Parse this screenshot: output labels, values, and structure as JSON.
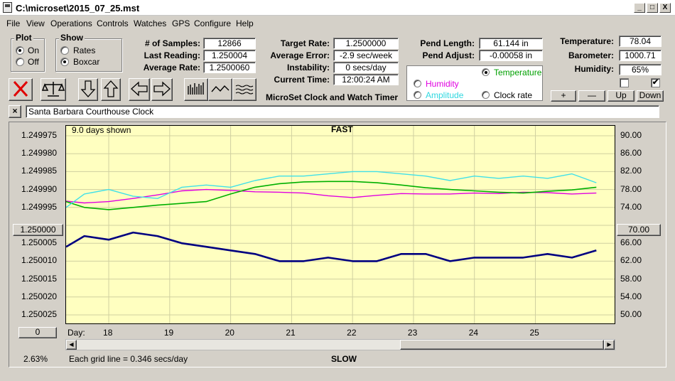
{
  "window": {
    "title": "C:\\microset\\2015_07_25.mst",
    "minimize": "_",
    "maximize": "□",
    "close": "X"
  },
  "menu": [
    "File",
    "View",
    "Operations",
    "Controls",
    "Watches",
    "GPS",
    "Configure",
    "Help"
  ],
  "plot_group": {
    "title": "Plot",
    "on": "On",
    "off": "Off",
    "selected": "On"
  },
  "show_group": {
    "title": "Show",
    "rates": "Rates",
    "boxcar": "Boxcar",
    "selected": "Boxcar"
  },
  "stats": {
    "samples_label": "# of Samples:",
    "samples": "12866",
    "last_label": "Last Reading:",
    "last": "1.250004",
    "avg_label": "Average Rate:",
    "avg": "1.2500060"
  },
  "rates": {
    "target_label": "Target Rate:",
    "target": "1.2500000",
    "error_label": "Average Error:",
    "error": "-2.9 sec/week",
    "instab_label": "Instability:",
    "instab": "0 secs/day",
    "time_label": "Current Time:",
    "time": "12:00:24 AM"
  },
  "pend": {
    "length_label": "Pend Length:",
    "length": "61.144 in",
    "adjust_label": "Pend Adjust:",
    "adjust": "-0.00058 in"
  },
  "env": {
    "temp_label": "Temperature:",
    "temp": "78.04",
    "baro_label": "Barometer:",
    "baro": "1000.71",
    "hum_label": "Humidity:",
    "hum": "65%"
  },
  "aux_select": {
    "temperature": "Temperature",
    "humidity": "Humidity",
    "amplitude": "Amplitude",
    "clock_rate": "Clock rate",
    "selected": "Temperature"
  },
  "aux_buttons": {
    "plus": "+",
    "minus": "—",
    "up": "Up",
    "down": "Down"
  },
  "app_caption": "MicroSet Clock and Watch Timer",
  "description": "Santa Barbara Courthouse Clock",
  "toolbar_icons": [
    "stop-icon",
    "balance-icon",
    "arrow-down-icon",
    "arrow-up-icon",
    "arrow-left-icon",
    "arrow-right-icon",
    "bar-chart-icon",
    "wave-icon",
    "noise-icon"
  ],
  "colors": {
    "rate": "#000080",
    "temperature": "#00b000",
    "humidity": "#e000e0",
    "amplitude": "#40e0e8",
    "plot_bg": "#ffffc0"
  },
  "plot_labels": {
    "days_shown": "9.0 days shown",
    "fast": "FAST",
    "slow": "SLOW",
    "day_label": "Day:",
    "grid_note": "Each grid line = 0.346 secs/day",
    "percent": "2.63%",
    "left_center": "1.250000",
    "right_center": "70.00",
    "bottom_left": "0"
  },
  "chart_data": {
    "type": "line",
    "xlabel": "Day:",
    "x_ticks": [
      "18",
      "19",
      "20",
      "21",
      "22",
      "23",
      "24",
      "25"
    ],
    "xlim": [
      17.3,
      26.3
    ],
    "y_left_ticks": [
      "1.249975",
      "1.249980",
      "1.249985",
      "1.249990",
      "1.249995",
      "1.250000",
      "1.250005",
      "1.250010",
      "1.250015",
      "1.250020",
      "1.250025"
    ],
    "ylim_left": [
      1.250025,
      1.249975
    ],
    "y_right_ticks": [
      "90.00",
      "86.00",
      "82.00",
      "78.00",
      "74.00",
      "70.00",
      "66.00",
      "62.00",
      "58.00",
      "54.00",
      "50.00"
    ],
    "ylim_right": [
      50,
      90
    ],
    "grid": true,
    "series": [
      {
        "key": "rate",
        "axis": "left",
        "x": [
          17.3,
          17.6,
          18.0,
          18.4,
          18.8,
          19.2,
          19.6,
          20.0,
          20.4,
          20.8,
          21.2,
          21.6,
          22.0,
          22.4,
          22.8,
          23.2,
          23.6,
          24.0,
          24.4,
          24.8,
          25.2,
          25.6,
          26.0
        ],
        "y": [
          1.250006,
          1.250003,
          1.250004,
          1.250002,
          1.250003,
          1.250005,
          1.250006,
          1.250007,
          1.250008,
          1.25001,
          1.25001,
          1.250009,
          1.25001,
          1.25001,
          1.250008,
          1.250008,
          1.25001,
          1.250009,
          1.250009,
          1.250009,
          1.250008,
          1.250009,
          1.250007
        ]
      },
      {
        "key": "temperature",
        "axis": "right",
        "x": [
          17.3,
          17.6,
          18.0,
          18.4,
          18.8,
          19.2,
          19.6,
          20.0,
          20.4,
          20.8,
          21.2,
          21.6,
          22.0,
          22.4,
          22.8,
          23.2,
          23.6,
          24.0,
          24.4,
          24.8,
          25.2,
          25.6,
          26.0
        ],
        "y": [
          75.3,
          74.0,
          73.5,
          74.0,
          74.5,
          74.9,
          75.3,
          77.0,
          78.5,
          79.3,
          79.7,
          79.8,
          79.8,
          79.5,
          79.0,
          78.4,
          78.0,
          77.7,
          77.4,
          77.2,
          77.6,
          77.9,
          78.5
        ]
      },
      {
        "key": "humidity",
        "axis": "right",
        "x": [
          17.3,
          17.6,
          18.0,
          18.4,
          18.8,
          19.2,
          19.6,
          20.0,
          20.4,
          20.8,
          21.2,
          21.6,
          22.0,
          22.4,
          22.8,
          23.2,
          23.6,
          24.0,
          24.4,
          24.8,
          25.2,
          25.6,
          26.0
        ],
        "y": [
          75.4,
          75.0,
          75.3,
          76.0,
          76.8,
          77.7,
          78.0,
          77.8,
          77.5,
          77.4,
          77.2,
          76.6,
          76.2,
          76.7,
          77.1,
          77.0,
          77.0,
          77.2,
          77.1,
          77.4,
          77.3,
          77.0,
          77.2
        ]
      },
      {
        "key": "amplitude",
        "axis": "right",
        "x": [
          17.3,
          17.6,
          18.0,
          18.4,
          18.8,
          19.2,
          19.6,
          20.0,
          20.4,
          20.8,
          21.2,
          21.6,
          22.0,
          22.4,
          22.8,
          23.2,
          23.6,
          24.0,
          24.4,
          24.8,
          25.2,
          25.6,
          26.0
        ],
        "y": [
          74.0,
          77.0,
          78.0,
          76.5,
          76.0,
          78.5,
          79.0,
          78.5,
          80.0,
          81.0,
          81.0,
          81.5,
          82.0,
          82.0,
          81.5,
          81.0,
          80.0,
          81.0,
          80.5,
          81.0,
          80.5,
          81.5,
          79.5
        ]
      }
    ]
  }
}
